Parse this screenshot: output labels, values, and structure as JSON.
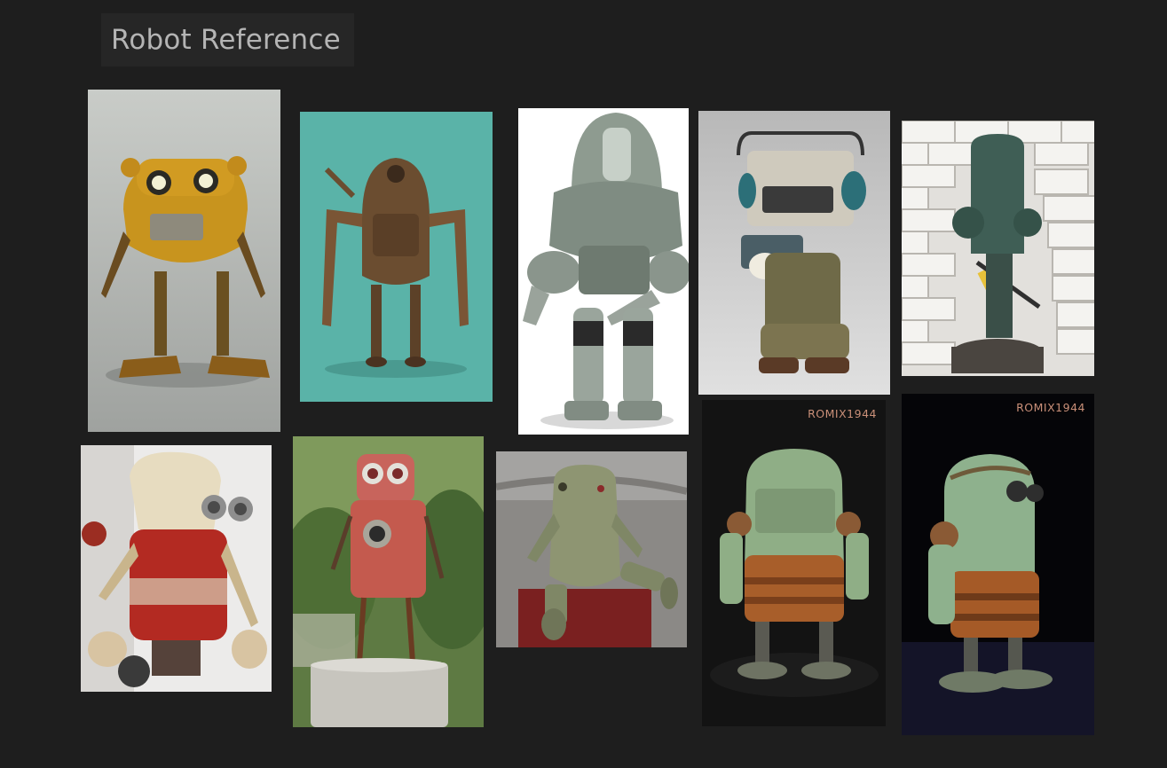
{
  "board": {
    "title": "Robot Reference"
  },
  "images": [
    {
      "name": "yellow-bear-robot",
      "watermark": ""
    },
    {
      "name": "rusty-teal-robot",
      "watermark": ""
    },
    {
      "name": "grey-dome-robot",
      "watermark": ""
    },
    {
      "name": "cassette-head-robot",
      "watermark": ""
    },
    {
      "name": "tank-robot-bricks",
      "watermark": ""
    },
    {
      "name": "red-white-scrap-robot",
      "watermark": ""
    },
    {
      "name": "red-garden-robot",
      "watermark": ""
    },
    {
      "name": "green-sitting-robot",
      "watermark": ""
    },
    {
      "name": "green-rust-robot-front",
      "watermark": "ROMIX1944"
    },
    {
      "name": "green-rust-robot-side",
      "watermark": "ROMIX1944"
    }
  ],
  "colors": {
    "background": "#1e1e1e",
    "title_box": "#262626",
    "title_text": "#b4b4b4"
  }
}
